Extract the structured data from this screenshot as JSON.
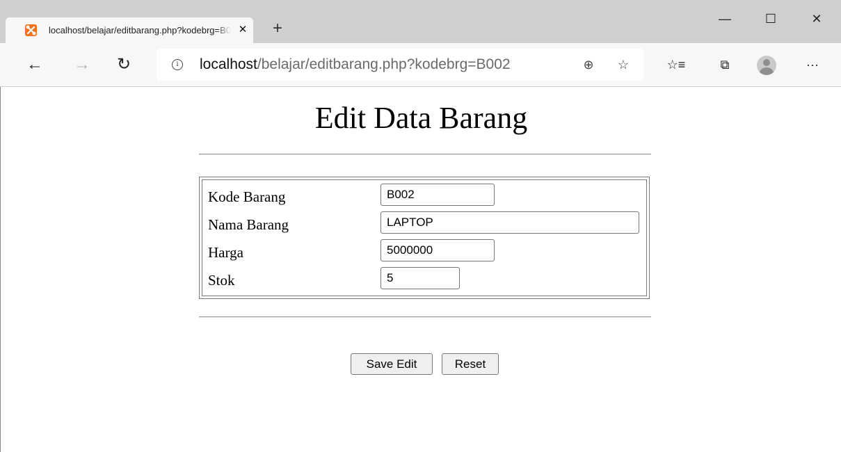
{
  "browser": {
    "tab": {
      "title": "localhost/belajar/editbarang.php?kodebrg=B002",
      "close": "✕",
      "favicon": "xampp-icon"
    },
    "new_tab": "+",
    "window_controls": {
      "minimize": "—",
      "maximize": "☐",
      "close": "✕"
    },
    "nav": {
      "back": "←",
      "forward": "→",
      "refresh": "↻"
    },
    "address": {
      "info": "i",
      "host": "localhost",
      "path": "/belajar/editbarang.php?kodebrg=B002"
    },
    "icons": {
      "zoom": "⊕",
      "favorite": "☆",
      "favorites_list": "☆≡",
      "collections": "⧉",
      "more": "···"
    }
  },
  "page": {
    "title": "Edit Data Barang",
    "form": {
      "rows": [
        {
          "label": "Kode Barang",
          "value": "B002"
        },
        {
          "label": "Nama Barang",
          "value": "LAPTOP"
        },
        {
          "label": "Harga",
          "value": "5000000"
        },
        {
          "label": "Stok",
          "value": "5"
        }
      ]
    },
    "buttons": {
      "save": "Save Edit",
      "reset": "Reset"
    }
  }
}
